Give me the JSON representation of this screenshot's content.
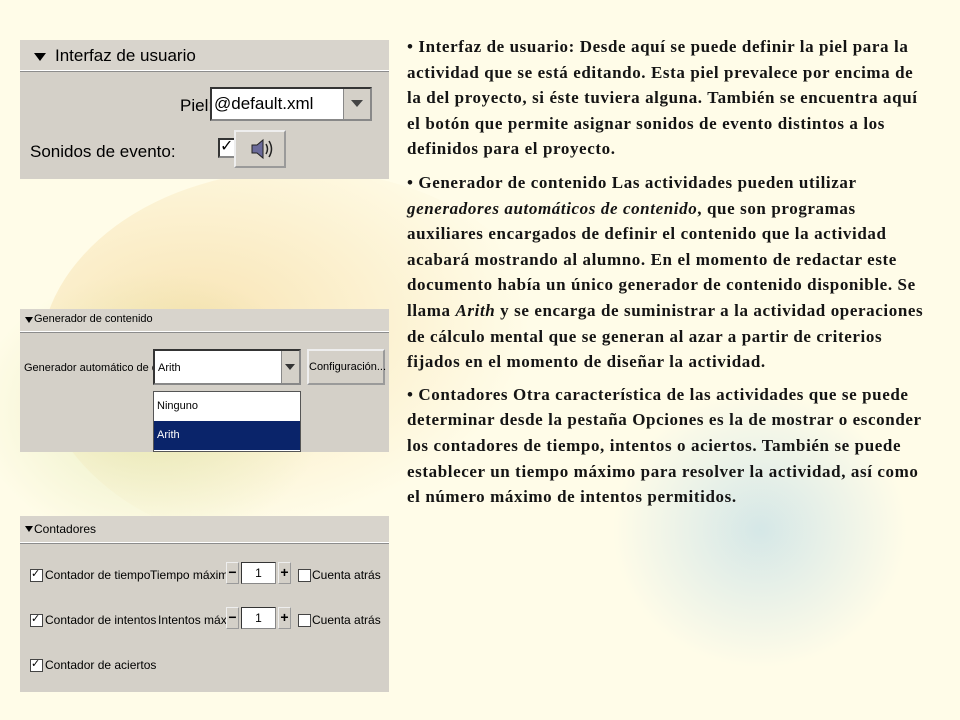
{
  "panel_interfaz": {
    "header": "Interfaz de usuario",
    "piel_label": "Piel:",
    "piel_value": "@default.xml",
    "sonidos_label": "Sonidos de evento:",
    "sonidos_checked": true,
    "sound_icon": "speaker-icon"
  },
  "panel_generador": {
    "header": "Generador de contenido",
    "label": "Generador automático de contenido:",
    "selected": "Arith",
    "config_button": "Configuración...",
    "options": [
      "Ninguno",
      "Arith"
    ]
  },
  "panel_contadores": {
    "header": "Contadores",
    "rows": [
      {
        "label": "Contador de tiempo",
        "checked": true,
        "max_label": "Tiempo máximo:",
        "value": "1",
        "countdown_label": "Cuenta atrás",
        "countdown_checked": false
      },
      {
        "label": "Contador de intentos",
        "checked": true,
        "max_label": "Intentos máx.:",
        "value": "1",
        "countdown_label": "Cuenta atrás",
        "countdown_checked": false
      },
      {
        "label": "Contador de aciertos",
        "checked": true
      }
    ]
  },
  "text": {
    "p1": "• Interfaz de usuario: Desde aquí se puede definir la piel para la actividad que se está editando. Esta piel prevalece por encima de la del proyecto, si éste tuviera alguna. También se encuentra aquí el botón que permite asignar sonidos de evento distintos a los definidos para el proyecto.",
    "p2_a": "• Generador de contenido Las actividades pueden utilizar ",
    "p2_em1": "generadores automáticos de contenido",
    "p2_b": ", que son programas auxiliares encargados de definir el contenido que la actividad acabará mostrando al alumno. En el momento de redactar este documento había un único generador de contenido disponible. Se llama ",
    "p2_em2": "Arith",
    "p2_c": " y se encarga de suministrar a la actividad operaciones de cálculo mental que se generan al azar a partir de criterios fijados en el momento de diseñar la actividad.",
    "p3": "• Contadores Otra característica de las actividades que se puede determinar desde la pestaña Opciones es la de mostrar o esconder los contadores de tiempo, intentos o aciertos. También se puede establecer un tiempo máximo para resolver la actividad, así como el número máximo de intentos permitidos."
  },
  "colors": {
    "panel_bg": "#d4d0c8",
    "selection": "#0a246a",
    "page_bg": "#fffce8"
  }
}
